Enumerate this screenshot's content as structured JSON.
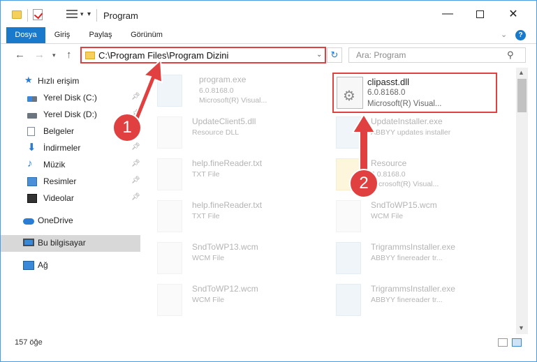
{
  "window": {
    "title": "Program"
  },
  "ribbon": {
    "tabs": [
      "Dosya",
      "Giriş",
      "Paylaş",
      "Görünüm"
    ],
    "help_label": "?"
  },
  "nav": {
    "address": "C:\\Program Files\\Program Dizini",
    "search_placeholder": "Ara: Program"
  },
  "sidebar": {
    "items": [
      {
        "label": "Hızlı erişim",
        "icon": "star-icon"
      },
      {
        "label": "Yerel Disk (C:)",
        "icon": "disk-icon"
      },
      {
        "label": "Yerel Disk (D:)",
        "icon": "disk-icon"
      },
      {
        "label": "Belgeler",
        "icon": "document-icon"
      },
      {
        "label": "İndirmeler",
        "icon": "download-icon"
      },
      {
        "label": "Müzik",
        "icon": "music-icon"
      },
      {
        "label": "Resimler",
        "icon": "pictures-icon"
      },
      {
        "label": "Videolar",
        "icon": "video-icon"
      },
      {
        "label": "OneDrive",
        "icon": "cloud-icon"
      },
      {
        "label": "Bu bilgisayar",
        "icon": "computer-icon"
      },
      {
        "label": "Ağ",
        "icon": "network-icon"
      }
    ]
  },
  "files": [
    {
      "name": "program.exe",
      "line1": "6.0.8168.0",
      "line2": "Microsoft(R) Visual..."
    },
    {
      "name": "clipasst.dll",
      "line1": "6.0.8168.0",
      "line2": "Microsoft(R) Visual..."
    },
    {
      "name": "UpdateClient5.dll",
      "line1": "Resource DLL",
      "line2": ""
    },
    {
      "name": "UpdateInstaller.exe",
      "line1": "ABBYY updates installer",
      "line2": ""
    },
    {
      "name": "help.fineReader.txt",
      "line1": "TXT File",
      "line2": ""
    },
    {
      "name": "Resource",
      "line1": "6.0.8168.0",
      "line2": "Microsoft(R) Visual..."
    },
    {
      "name": "help.fineReader.txt",
      "line1": "TXT File",
      "line2": ""
    },
    {
      "name": "SndToWP15.wcm",
      "line1": "WCM File",
      "line2": ""
    },
    {
      "name": "SndToWP13.wcm",
      "line1": "WCM File",
      "line2": ""
    },
    {
      "name": "TrigrammsInstaller.exe",
      "line1": "ABBYY finereader tr...",
      "line2": ""
    },
    {
      "name": "SndToWP12.wcm",
      "line1": "WCM File",
      "line2": ""
    },
    {
      "name": "TrigrammsInstaller.exe",
      "line1": "ABBYY finereader tr...",
      "line2": ""
    }
  ],
  "status": {
    "item_count": "157 öğe"
  },
  "annotations": {
    "badge1": "1",
    "badge2": "2",
    "color": "#e04040"
  }
}
